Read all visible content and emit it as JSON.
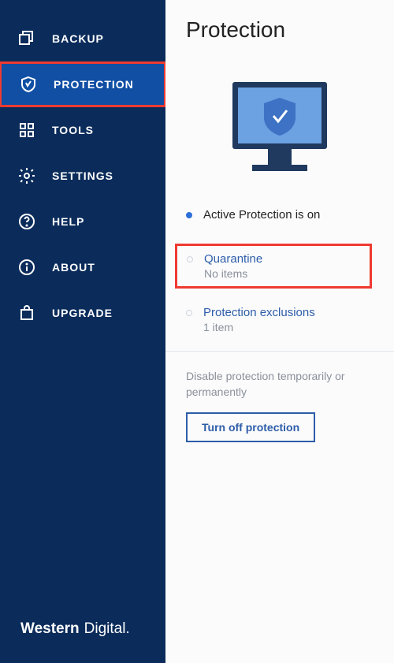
{
  "sidebar": {
    "items": [
      {
        "label": "BACKUP"
      },
      {
        "label": "PROTECTION"
      },
      {
        "label": "TOOLS"
      },
      {
        "label": "SETTINGS"
      },
      {
        "label": "HELP"
      },
      {
        "label": "ABOUT"
      },
      {
        "label": "UPGRADE"
      }
    ],
    "brand_first": "Western",
    "brand_second": "Digital."
  },
  "main": {
    "title": "Protection",
    "status": "Active Protection is on",
    "quarantine": {
      "title": "Quarantine",
      "sub": "No items"
    },
    "exclusions": {
      "title": "Protection exclusions",
      "sub": "1 item"
    },
    "footer_text": "Disable protection temporarily or permanently",
    "off_button": "Turn off protection"
  }
}
